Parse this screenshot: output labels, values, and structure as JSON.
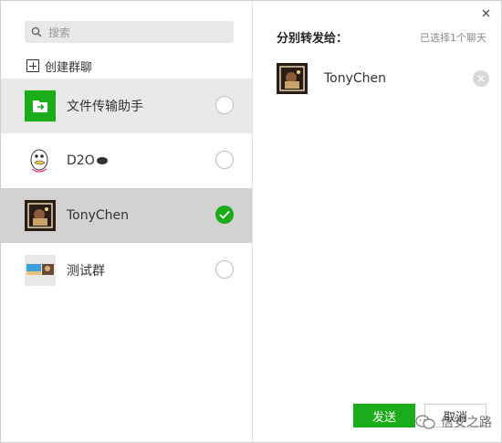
{
  "search": {
    "placeholder": "搜索",
    "icon": "search-icon"
  },
  "create_group": {
    "label": "创建群聊",
    "icon": "plus-box-icon"
  },
  "contacts": [
    {
      "name": "文件传输助手",
      "avatar": "file-transfer-icon",
      "checked": false,
      "state": "hover"
    },
    {
      "name": "D2O",
      "avatar": "duck-avatar",
      "checked": false,
      "state": "normal"
    },
    {
      "name": "TonyChen",
      "avatar": "photo-avatar",
      "checked": true,
      "state": "selected"
    },
    {
      "name": "测试群",
      "avatar": "group-avatar",
      "checked": false,
      "state": "normal"
    }
  ],
  "right_panel": {
    "title": "分别转发给：",
    "selected_count": "已选择1个聊天",
    "chosen": [
      {
        "name": "TonyChen"
      }
    ],
    "send_label": "发送",
    "cancel_label": "取消"
  },
  "watermark": {
    "text": "信安之路"
  },
  "colors": {
    "accent": "#1aad19",
    "selected_row": "#d2d2d2",
    "hover_row": "#e9e9e9"
  }
}
